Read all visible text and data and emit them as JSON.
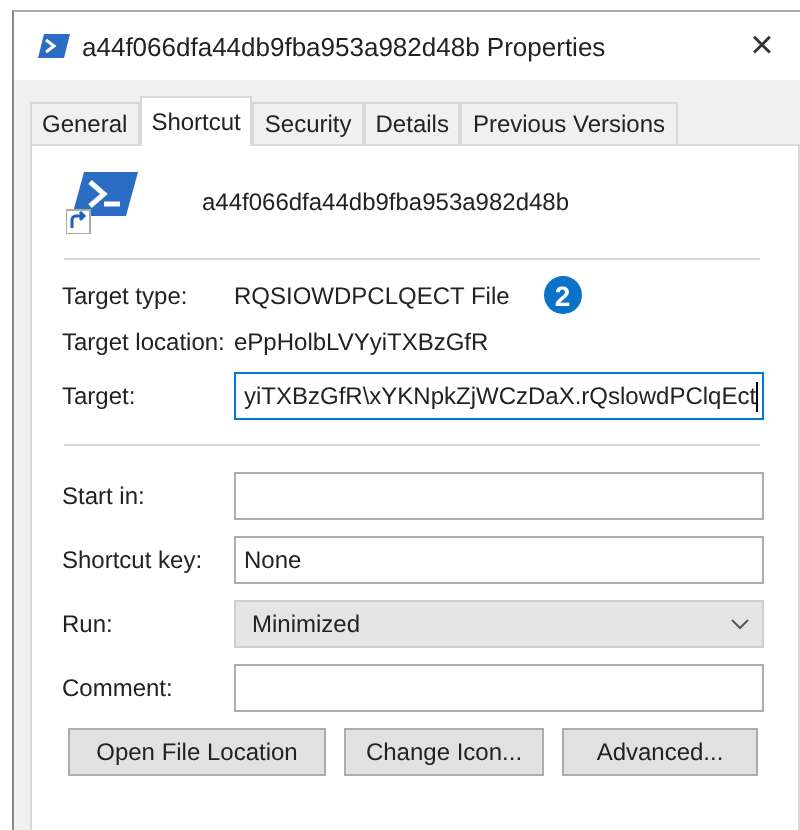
{
  "window": {
    "title": "a44f066dfa44db9fba953a982d48b Properties",
    "close": "×"
  },
  "tabs": [
    {
      "label": "General",
      "selected": false
    },
    {
      "label": "Shortcut",
      "selected": true
    },
    {
      "label": "Security",
      "selected": false
    },
    {
      "label": "Details",
      "selected": false
    },
    {
      "label": "Previous Versions",
      "selected": false
    }
  ],
  "header": {
    "name": "a44f066dfa44db9fba953a982d48b"
  },
  "info": [
    {
      "label": "Target type:",
      "value": "RQSIOWDPCLQECT File",
      "badge": "2"
    },
    {
      "label": "Target location:",
      "value": "ePpHolbLVYyiTXBzGfR"
    }
  ],
  "fields": [
    {
      "kind": "text",
      "label": "Target:",
      "value": "yiTXBzGfR\\xYKNpkZjWCzDaX.rQslowdPClqEct",
      "focused": true
    },
    {
      "kind": "text",
      "label": "Start in:",
      "focused": false
    },
    {
      "kind": "text",
      "label": "Shortcut key:",
      "value": "None",
      "focused": false
    },
    {
      "kind": "dropdown",
      "label": "Run:",
      "value": "Minimized",
      "focused": false
    },
    {
      "kind": "text",
      "label": "Comment:",
      "focused": false
    }
  ],
  "buttons": [
    "Open File Location",
    "Change Icon...",
    "Advanced..."
  ]
}
